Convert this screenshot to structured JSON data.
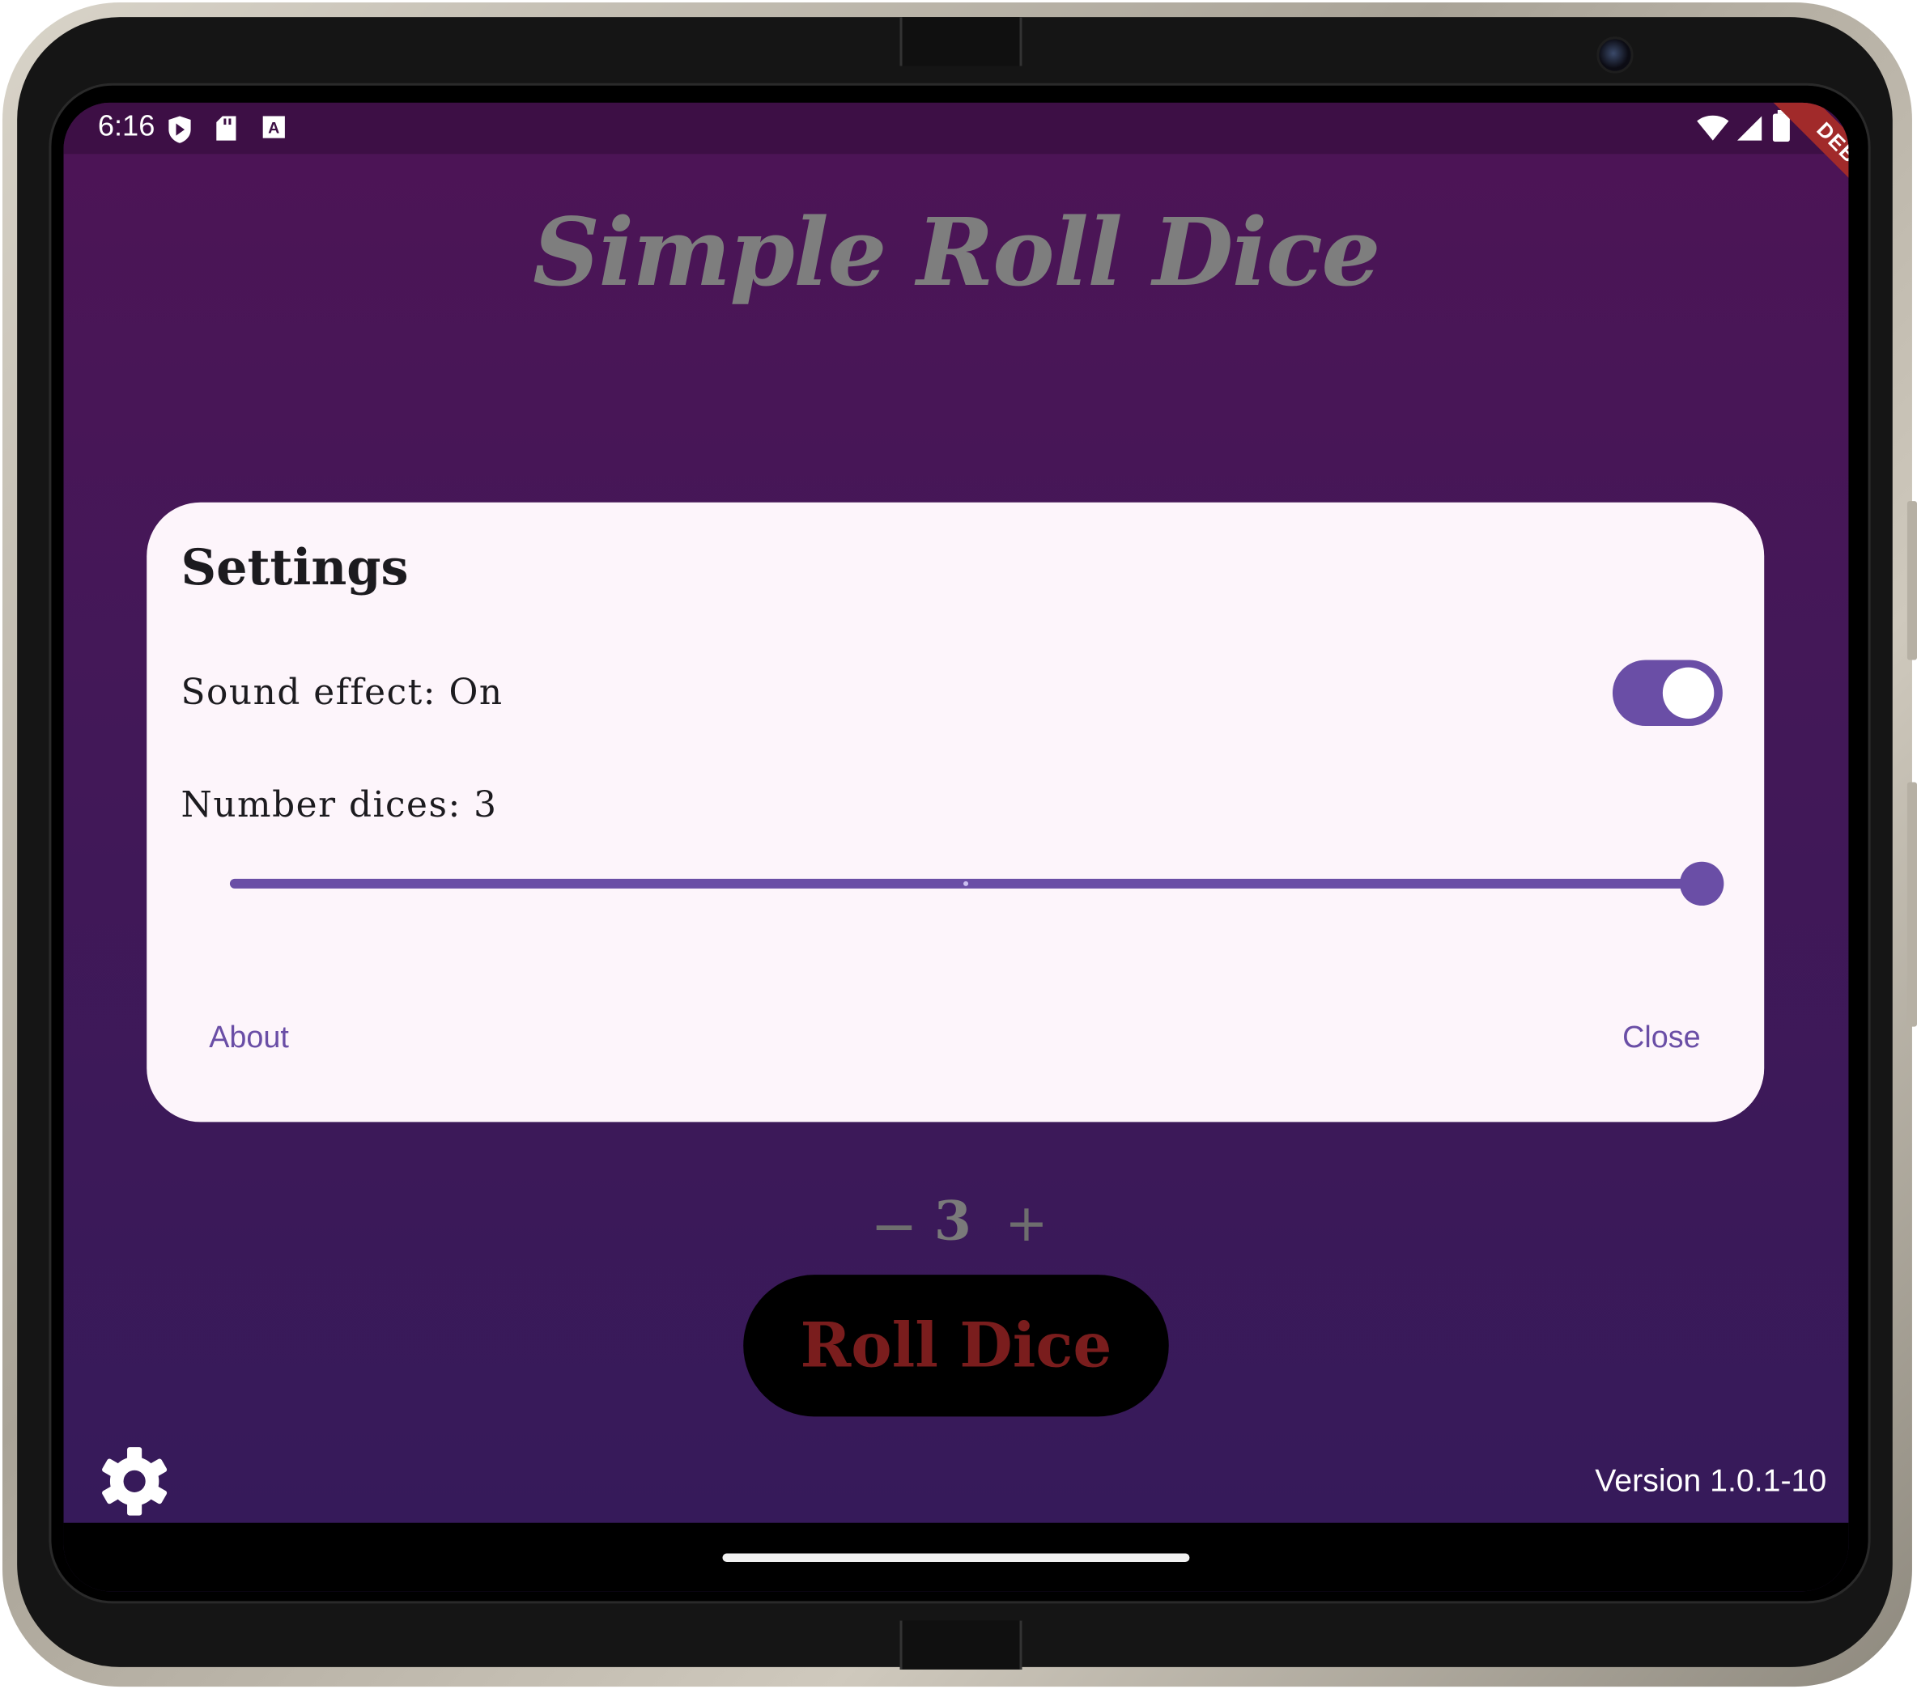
{
  "status_bar": {
    "time": "6:16",
    "left_icons": [
      "play-protect-icon",
      "sd-card-icon",
      "keyboard-a-icon"
    ],
    "right_icons": [
      "wifi-icon",
      "signal-icon",
      "battery-icon"
    ]
  },
  "debug_banner": "DEBUG",
  "app": {
    "title": "Simple Roll Dice",
    "dice_count": "3",
    "decrement_symbol": "−",
    "increment_symbol": "+",
    "roll_button_label": "Roll Dice",
    "version_label": "Version 1.0.1-10",
    "settings_icon": "gear-icon"
  },
  "settings_dialog": {
    "title": "Settings",
    "sound_label": "Sound effect: On",
    "sound_enabled": true,
    "dices_label": "Number dices: 3",
    "slider": {
      "min": 1,
      "max": 3,
      "value": 3
    },
    "about_label": "About",
    "close_label": "Close"
  },
  "colors": {
    "accent": "#6a4ea6",
    "background_top": "#4d1456",
    "background_bottom": "#351a5a",
    "dialog_surface": "#fdf5fb",
    "roll_text": "#7a1d1d"
  }
}
